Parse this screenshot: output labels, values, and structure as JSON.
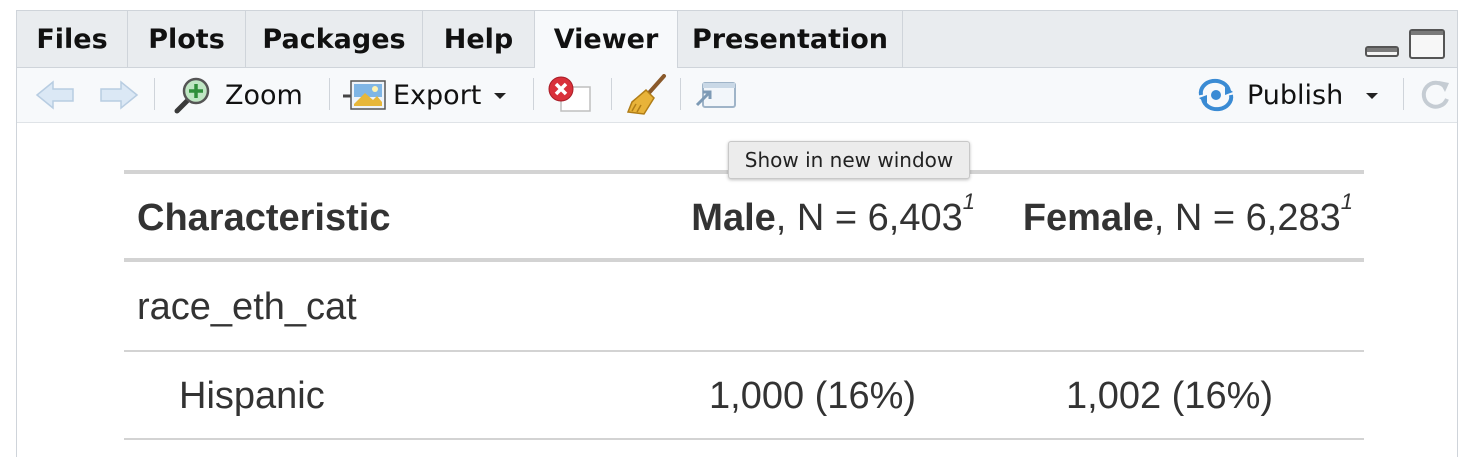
{
  "tabs": [
    {
      "label": "Files"
    },
    {
      "label": "Plots"
    },
    {
      "label": "Packages"
    },
    {
      "label": "Help"
    },
    {
      "label": "Viewer"
    },
    {
      "label": "Presentation"
    }
  ],
  "active_tab": "Viewer",
  "toolbar": {
    "zoom_label": "Zoom",
    "export_label": "Export",
    "publish_label": "Publish"
  },
  "tooltip": "Show in new window",
  "table": {
    "header": {
      "characteristic": "Characteristic",
      "male_label": "Male",
      "male_n": ", N = 6,403",
      "female_label": "Female",
      "female_n": ", N = 6,283",
      "footnote_mark": "1"
    },
    "group_label": "race_eth_cat",
    "rows": [
      {
        "label": "Hispanic",
        "male": "1,000 (16%)",
        "female": "1,002 (16%)"
      }
    ]
  },
  "colors": {
    "publish_blue": "#3a8bd4",
    "close_red": "#d9303a"
  }
}
